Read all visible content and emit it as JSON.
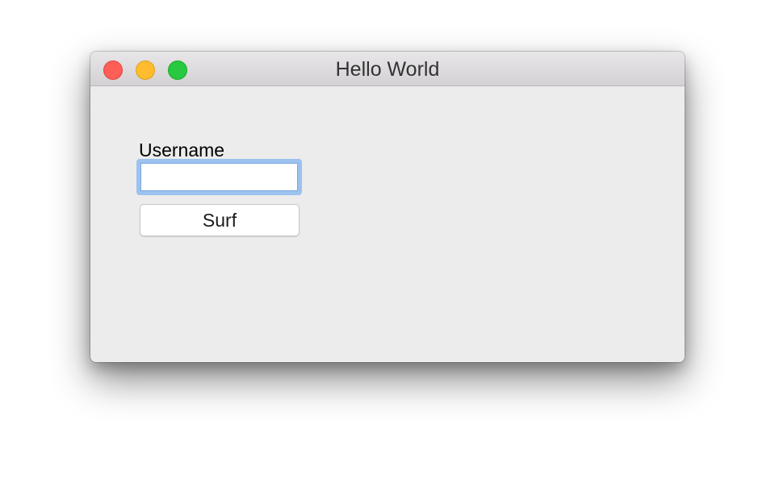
{
  "window": {
    "title": "Hello World",
    "controls": {
      "close_color": "#fd5f57",
      "minimize_color": "#febc2e",
      "zoom_color": "#28c840"
    }
  },
  "form": {
    "username_label": "Username",
    "username_value": "",
    "username_placeholder": "",
    "submit_label": "Surf",
    "focus_ring_color": "#9cc2ef"
  }
}
